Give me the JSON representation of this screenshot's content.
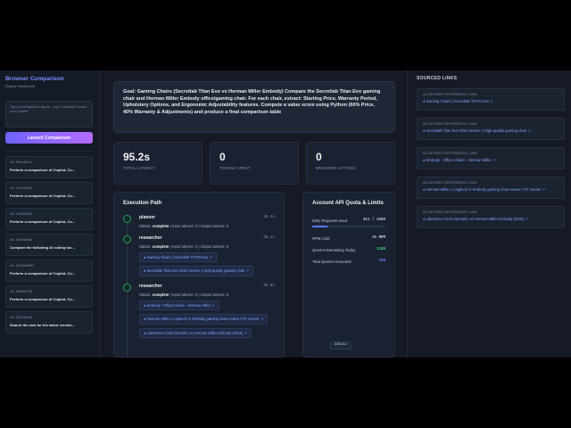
{
  "sidebar": {
    "title": "Browser Comparison",
    "subtitle": "Replay Dashboard",
    "query_placeholder": "Type a comparison query... e.g. Compare Cursor and Copilot",
    "launch_label": "Launch Comparison",
    "sessions": [
      {
        "id": "c8-0fcc0b71",
        "title": "Perform a comparison of Copilot, Cu..."
      },
      {
        "id": "c8-1c3c0102",
        "title": "Perform a comparison of Copilot, Cu..."
      },
      {
        "id": "c8-1dd20382",
        "title": "Perform a comparison of Copilot, Cu..."
      },
      {
        "id": "c8-2d0ca09e",
        "title": "Compare the following AI coding too..."
      },
      {
        "id": "c8-2bf0a0087",
        "title": "Perform a comparison of Copilot, Cu..."
      },
      {
        "id": "c8-2958e739",
        "title": "Perform a comparison of Copilot, Cu..."
      },
      {
        "id": "c8-33b79cbb",
        "title": "Search the web for the latest version..."
      }
    ]
  },
  "goal": "Goal: Gaming Chairs (Secretlab Titan Evo vs Herman Miller Embody) Compare the Secretlab Titan Evo gaming chair and Herman Miller Embody office/gaming chair. For each chair, extract: Starting Price, Warranty Period, Upholstery Options, and Ergonomic Adjustability features. Compute a value score using Python (60% Price, 40% Warranty & Adjustments) and produce a final comparison table",
  "stats": [
    {
      "value": "95.2s",
      "label": "TOTAL LATENCY"
    },
    {
      "value": "0",
      "label": "TOKENS SPENT"
    },
    {
      "value": "0",
      "label": "BROWSER ACTIONS"
    }
  ],
  "execution": {
    "title": "Execution Path",
    "steps": [
      {
        "name": "planner",
        "time": "10.4s",
        "status_prefix": "Status: ",
        "status": "complete",
        "status_suffix": " | Input tokens: 0 | Output tokens: 0",
        "links": []
      },
      {
        "name": "researcher",
        "time": "35.1s",
        "status_prefix": "Status: ",
        "status": "complete",
        "status_suffix": " | Input tokens: 0 | Output tokens: 0",
        "links": [
          "Gaming Chairs | Secretlab TITAN Evo ↗",
          "Secretlab Titan Evo 2022 review: A high-quality gaming chair ↗"
        ]
      },
      {
        "name": "researcher",
        "time": "35.6s",
        "status_prefix": "Status: ",
        "status": "complete",
        "status_suffix": " | Input tokens: 0 | Output tokens: 0",
        "links": [
          "Embody - Office Chairs - Herman Miller ↗",
          "Herman Miller x Logitech G Embody gaming chair review | PC Gamer ↗",
          "LiberNovo Omni Dynamic vs Herman Miller Embody (2026) ↗"
        ]
      }
    ]
  },
  "quota": {
    "title": "Account API Quota & Limits",
    "daily_label": "Daily Requests Used",
    "daily_value": "311 / 1500",
    "daily_fraction": 0.207,
    "rpm_label": "RPM Limit",
    "rpm_value": "15 RPM",
    "remaining_label": "Queries Remaining Today:",
    "remaining_value": "1189",
    "total_label": "Total Queries Executed:",
    "total_value": "768",
    "colors": {
      "remaining": "#3ddc84",
      "total": "#6c8cff"
    }
  },
  "tag": "88Edit",
  "sourced": {
    "title": "SOURCED LINKS",
    "label": "ACCESSED REFERENCE LINK",
    "links": [
      "Gaming Chairs | Secretlab TITAN Evo ↗",
      "Secretlab Titan Evo 2022 review: A high-quality gaming chair ↗",
      "Embody - Office Chairs - Herman Miller ↗",
      "Herman Miller x Logitech G Embody gaming chair review | PC Gamer ↗",
      "LiberNovo Omni Dynamic vs Herman Miller Embody (2026) ↗"
    ]
  }
}
